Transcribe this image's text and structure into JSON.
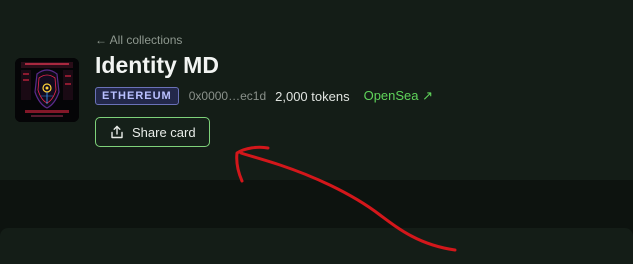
{
  "header": {
    "back_link": "← All collections",
    "title": "Identity MD",
    "chain_badge": "ETHEREUM",
    "contract_address": "0x0000…ec1d",
    "token_count": "2,000 tokens",
    "marketplace_link": "OpenSea ↗"
  },
  "actions": {
    "share_label": "Share card",
    "share_icon": "share-upload-icon"
  },
  "colors": {
    "accent_green": "#5fd35a",
    "button_border": "#7ed27a",
    "badge_bg": "#23284a",
    "badge_text": "#b9c0ff",
    "annotation_red": "#d3171b"
  }
}
